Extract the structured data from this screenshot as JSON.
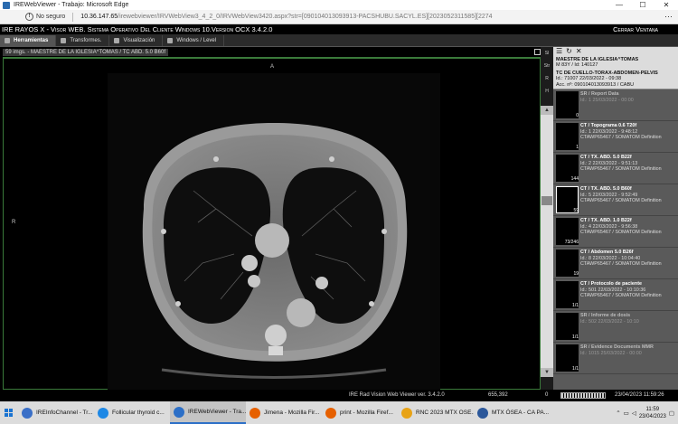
{
  "browser": {
    "title": "IREWebViewer - Trabajo: Microsoft Edge",
    "security": "No seguro",
    "url_host": "10.36.147.65",
    "url_rest": "/irewebviewer/IRVWebView3_4_2_0/IRVWebView3420.aspx?str=[090104013093913-PACSHUBU.SACYL.ES][2023052311585][2274",
    "min": "—",
    "max": "☐",
    "close": "✕"
  },
  "app": {
    "title": "IRE RAYOS X - Visor WEB. Sistema Operativo Del Cliente Windows 10.Version OCX 3.4.2.0",
    "close_label": "Cerrar Ventana"
  },
  "toolbar": {
    "tabs": [
      {
        "label": "Herramientas"
      },
      {
        "label": "Transformes."
      },
      {
        "label": "Visualización"
      },
      {
        "label": "Windows / Level"
      }
    ]
  },
  "viewport": {
    "header": "59 imgs. - MAESTRE DE LA IGLESIA^TOMAS / TC ABD. 5.0 B60f",
    "orient_top": "A",
    "orient_left": "R"
  },
  "side_tools": [
    "Sl",
    "Str",
    "R",
    "H"
  ],
  "patient": {
    "name": "MAESTRE DE LA IGLESIA^TOMAS",
    "line2": "M 83Y / Id: 140127",
    "study": "TC DE CUELLO-TORAX-ABDOMEN-PELVIS",
    "study_id": "Id.: 71007    22/03/2022 - 09:38",
    "accession": "Acc. nº: 090104013093913 / CABU"
  },
  "series": [
    {
      "title": "SR / Report Data",
      "l2": "Id.: 1    25/03/2022 - 00:00",
      "l3": "",
      "count": "0",
      "dim": true
    },
    {
      "title": "CT / Topograma  0.6  T20f",
      "l2": "Id.: 1    22/03/2022 - 9:48:12",
      "l3": "CTAWP65467 / SOMATOM Definition",
      "count": "1",
      "dim": false
    },
    {
      "title": "CT / TX. ABD.  5.0  B22f",
      "l2": "Id.: 2    22/03/2022 - 9:51:13",
      "l3": "CTAWP65467 / SOMATOM Definition",
      "count": "144",
      "dim": false
    },
    {
      "title": "CT / TX. ABD.  5.0  B60f",
      "l2": "Id.: 5    22/03/2022 - 9:52:49",
      "l3": "CTAWP65467 / SOMATOM Definition",
      "count": "59",
      "dim": false
    },
    {
      "title": "CT / TX. ABD.  1.0  B22f",
      "l2": "Id.: 4    22/03/2022 - 9:56:38",
      "l3": "CTAWP65467 / SOMATOM Definition",
      "count": "73/246",
      "dim": false
    },
    {
      "title": "CT / Abdomen  5.0  B26f",
      "l2": "Id.: 8    22/03/2022 - 10:04:40",
      "l3": "CTAWP65467 / SOMATOM Definition",
      "count": "19",
      "dim": false
    },
    {
      "title": "CT / Protocolo de paciente",
      "l2": "Id.: 501    22/03/2022 - 10:10:36",
      "l3": "CTAWP65467 / SOMATOM Definition",
      "count": "1/1",
      "dim": false
    },
    {
      "title": "SR / Informe de dosis",
      "l2": "Id.: 502    22/03/2022 - 10:10",
      "l3": "",
      "count": "1/1",
      "dim": true
    },
    {
      "title": "SR / Evidence Documents MMR",
      "l2": "Id.: 1015    25/03/2022 - 00:00",
      "l3": "",
      "count": "1/1",
      "dim": true
    }
  ],
  "status": {
    "viewer": "IRE Rad Vision Web Viewer ver. 3.4.2.0",
    "coords": "655,392",
    "zero": "0",
    "datetime": "23/04/2023 11:59:26"
  },
  "taskbar": {
    "tasks": [
      {
        "label": "IREInfoChannel - Tr...",
        "color": "#3a6fc7"
      },
      {
        "label": "Follicular thyroid c...",
        "color": "#1e88e5"
      },
      {
        "label": "IREWebViewer - Tra...",
        "color": "#2c6fc7"
      },
      {
        "label": "Jimena - Mozilla Fir...",
        "color": "#e66000"
      },
      {
        "label": "print - Mozilla Firef...",
        "color": "#e66000"
      },
      {
        "label": "RNC 2023 MTX OSE...",
        "color": "#e8a317"
      },
      {
        "label": "MTX ÓSEA - CA PA...",
        "color": "#2b579a"
      }
    ],
    "time": "11:59",
    "date": "23/04/2023"
  },
  "colors": {
    "panel_border": "#3a7a3a",
    "series_bg": "#5a5a5a",
    "taskbar_bg": "#dcdcdc"
  }
}
